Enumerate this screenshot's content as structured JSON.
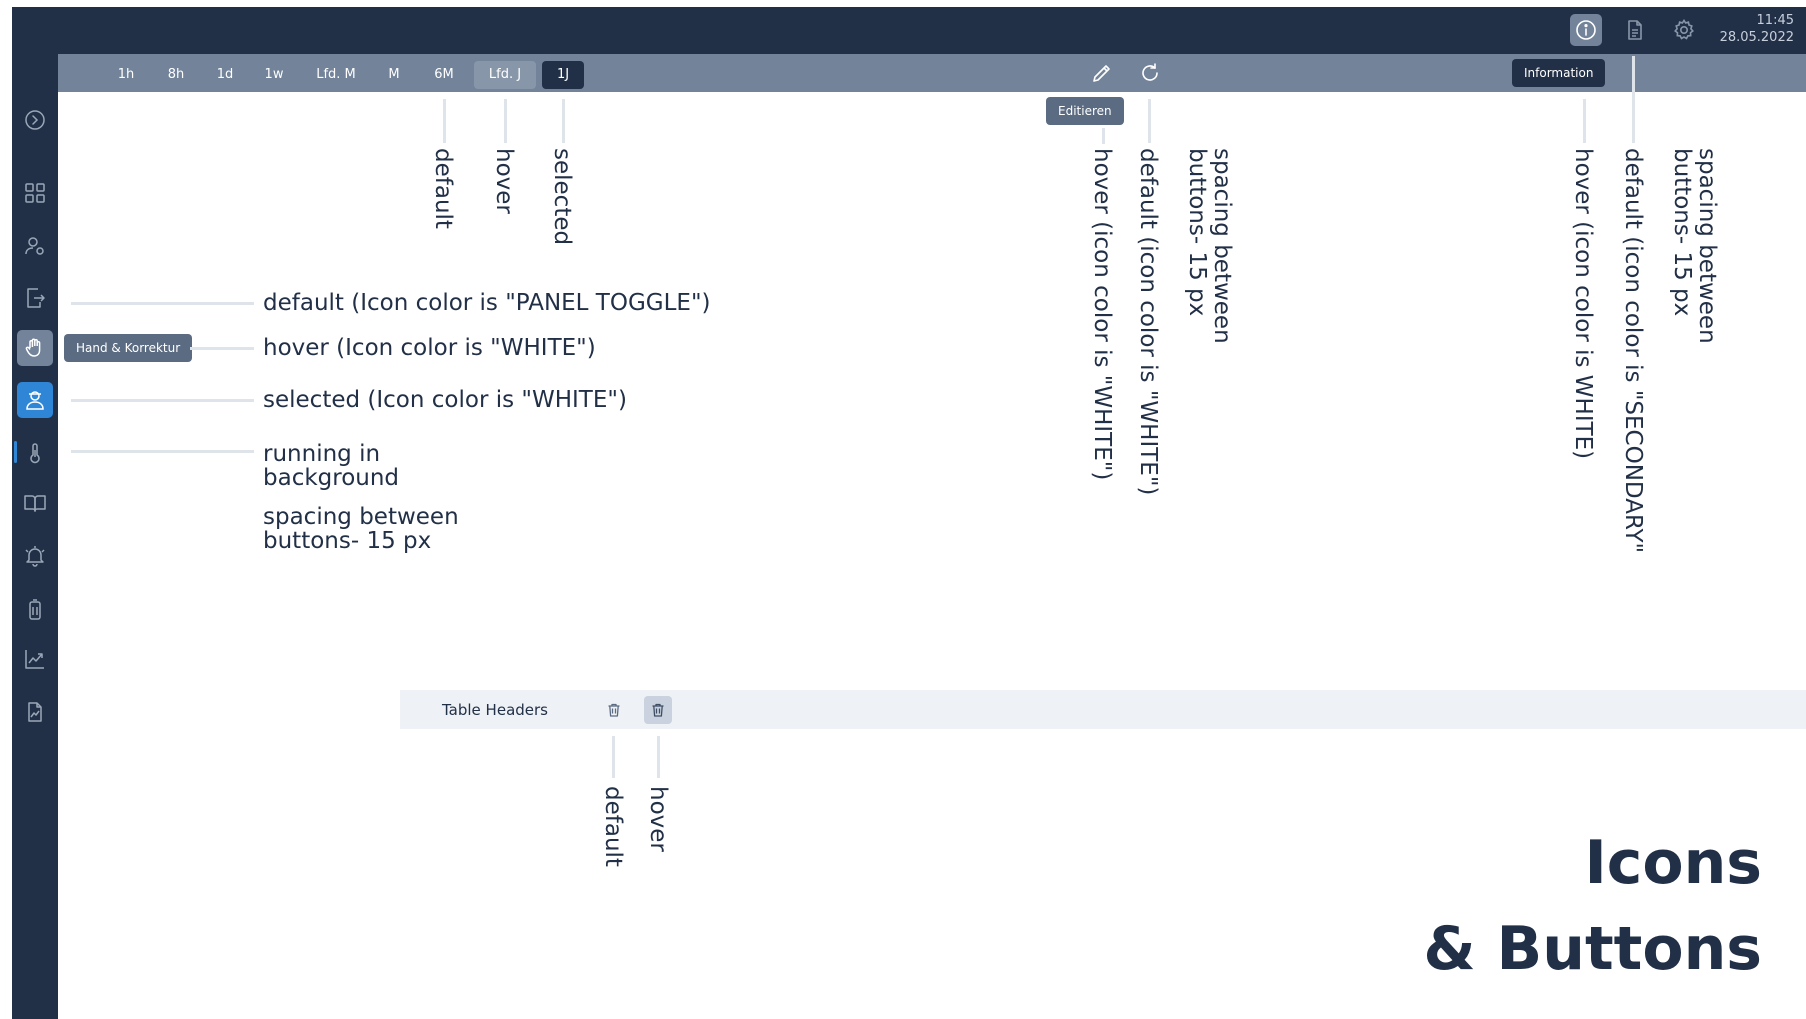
{
  "time_range": {
    "buttons": [
      "1h",
      "8h",
      "1d",
      "1w",
      "Lfd. M",
      "M",
      "6M",
      "Lfd. J",
      "1J"
    ]
  },
  "header": {
    "time": "11:45",
    "date": "28.05.2022",
    "icons": [
      "info-icon",
      "document-icon",
      "gear-icon"
    ]
  },
  "sidebar": {
    "icons": [
      "expand-icon",
      "dashboard-icon",
      "user-settings-icon",
      "export-icon",
      "hand-correction-icon",
      "operator-icon",
      "thermometer-icon",
      "book-icon",
      "alarm-icon",
      "battery-icon",
      "chart-icon",
      "report-icon"
    ]
  },
  "tooltips": {
    "edit": "Editieren",
    "information": "Information",
    "hand": "Hand & Korrektur"
  },
  "annotations": {
    "time_default": "default",
    "time_hover": "hover",
    "time_selected": "selected",
    "edit_hover": "hover (icon color is \"WHITE\")",
    "refresh_default": "default (icon color is \"WHITE\")",
    "spacing_mid": "spacing between\nbuttons- 15 px",
    "info_hover": "hover (icon color is WHITE)",
    "doc_default": "default (icon color is \"SECONDARY\"",
    "spacing_right": "spacing between\nbuttons- 15 px",
    "side_default": "default (Icon color is \"PANEL TOGGLE\")",
    "side_hover": "hover (Icon color is \"WHITE\")",
    "side_selected": "selected (Icon color is \"WHITE\")",
    "side_running": "running in\nbackground",
    "side_spacing": "spacing between\nbuttons- 15 px",
    "table_default": "default",
    "table_hover": "hover"
  },
  "table": {
    "header_label": "Table Headers"
  },
  "page_title": {
    "line1": "Icons",
    "line2": "& Buttons"
  },
  "colors": {
    "navy": "#223047",
    "slate": "#72839a",
    "accent_blue": "#2f86d6",
    "table_header_bg": "#eef1f5"
  }
}
